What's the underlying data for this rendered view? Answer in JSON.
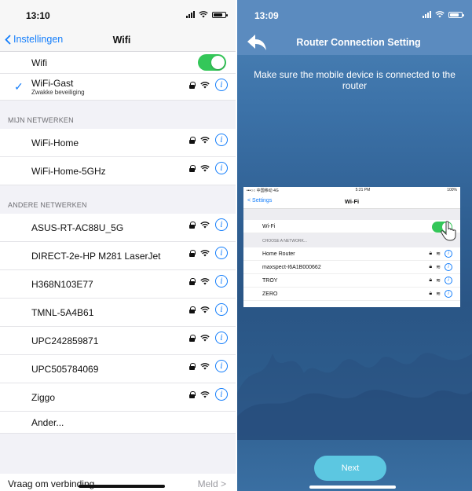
{
  "left": {
    "status": {
      "time": "13:10"
    },
    "nav": {
      "back_label": "Instellingen",
      "title": "Wifi"
    },
    "wifi_toggle": {
      "label": "Wifi",
      "on": true
    },
    "current_network": {
      "name": "WiFi-Gast",
      "subtitle": "Zwakke beveiliging"
    },
    "my_networks": {
      "header": "MIJN NETWERKEN",
      "items": [
        "WiFi-Home",
        "WiFi-Home-5GHz"
      ]
    },
    "other_networks": {
      "header": "ANDERE NETWERKEN",
      "items": [
        "ASUS-RT-AC88U_5G",
        "DIRECT-2e-HP M281 LaserJet",
        "H368N103E77",
        "TMNL-5A4B61",
        "UPC242859871",
        "UPC505784069",
        "Ziggo"
      ],
      "other_label": "Ander..."
    },
    "footer": {
      "label": "Vraag om verbinding",
      "value": "Meld >"
    }
  },
  "right": {
    "status": {
      "time": "13:09"
    },
    "nav": {
      "title": "Router Connection Setting"
    },
    "instruction": "Make sure the mobile device is connected to the router",
    "inner_screenshot": {
      "status_left": "•••○○ 中国移动 4G",
      "status_time": "5:21 PM",
      "status_right": "100%",
      "back_label": "< Settings",
      "title": "Wi-Fi",
      "wifi_label": "Wi-Fi",
      "choose_header": "CHOOSE A NETWORK...",
      "networks": [
        "Home Router",
        "maxspect-I6A1B000662",
        "TROY",
        "ZERO"
      ]
    },
    "next_button": "Next"
  },
  "colors": {
    "ios_blue": "#147efb",
    "toggle_green": "#34c759",
    "next_button": "#5cc7e1",
    "app_header": "#5b8bbf"
  }
}
